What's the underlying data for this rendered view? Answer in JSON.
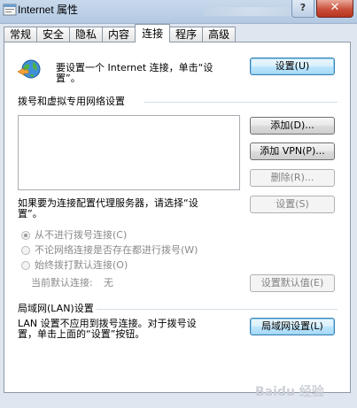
{
  "window": {
    "title": "Internet 属性",
    "close_glyph": "✕",
    "help_glyph": "?"
  },
  "tabs": [
    {
      "label": "常规"
    },
    {
      "label": "安全"
    },
    {
      "label": "隐私"
    },
    {
      "label": "内容"
    },
    {
      "label": "连接"
    },
    {
      "label": "程序"
    },
    {
      "label": "高级"
    }
  ],
  "active_tab": "连接",
  "setup": {
    "text_line1": "要设置一个 Internet 连接，单击“设",
    "text_line2": "置”。",
    "button": "设置(U)"
  },
  "dialup": {
    "heading": "拨号和虚拟专用网络设置",
    "list_items": [],
    "add_button": "添加(D)...",
    "add_vpn_button": "添加 VPN(P)...",
    "remove_button": "删除(R)...",
    "proxy_text_line1": "如果要为连接配置代理服务器，请选择“设",
    "proxy_text_line2": "置”。",
    "settings_button": "设置(S)",
    "radios": [
      {
        "label": "从不进行拨号连接(C)",
        "checked": true
      },
      {
        "label": "不论网络连接是否存在都进行拨号(W)",
        "checked": false
      },
      {
        "label": "始终拨打默认连接(O)",
        "checked": false
      }
    ],
    "current_default_label": "当前默认连接:",
    "current_default_value": "无",
    "set_default_button": "设置默认值(E)"
  },
  "lan": {
    "heading": "局域网(LAN)设置",
    "text_line1": "LAN 设置不应用到拨号连接。对于拨号设",
    "text_line2": "置，单击上面的“设置”按钮。",
    "button": "局域网设置(L)"
  },
  "watermark_text": "Baidu 经验",
  "colors": {
    "accent": "#3c7fb1",
    "window_frame": "#dfe6ef",
    "disabled_text": "#838383"
  }
}
